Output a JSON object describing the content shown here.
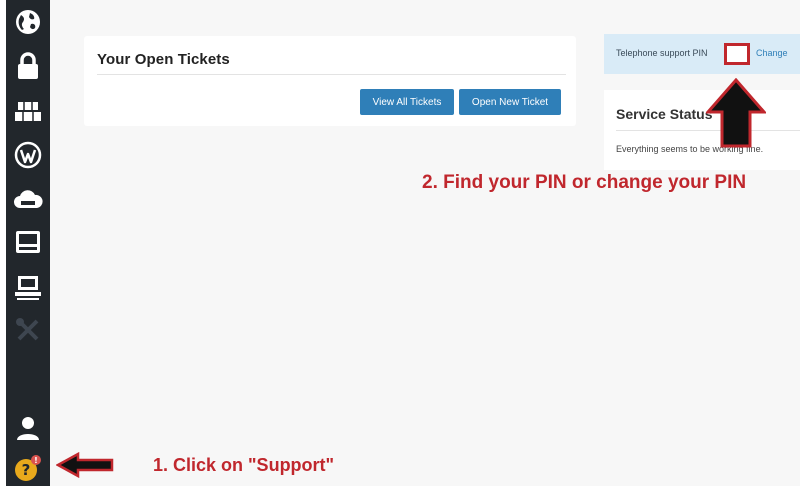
{
  "sidebar": {
    "items": [
      {
        "icon": "globe-icon"
      },
      {
        "icon": "lock-icon"
      },
      {
        "icon": "hosting-icon"
      },
      {
        "icon": "wordpress-icon"
      },
      {
        "icon": "cloud-icon"
      },
      {
        "icon": "server-icon"
      },
      {
        "icon": "dedicated-server-icon"
      },
      {
        "icon": "tools-icon"
      },
      {
        "icon": "user-icon"
      },
      {
        "icon": "support-icon",
        "badge": "!"
      }
    ]
  },
  "tickets": {
    "title": "Your Open Tickets",
    "view_all_label": "View All Tickets",
    "open_new_label": "Open New Ticket"
  },
  "pin": {
    "label": "Telephone support PIN",
    "change_label": "Change"
  },
  "service_status": {
    "title": "Service Status",
    "message": "Everything seems to be working fine."
  },
  "annotations": {
    "step1": "1. Click on \"Support\"",
    "step2": "2. Find your PIN or change your PIN"
  },
  "colors": {
    "sidebar_bg": "#22272c",
    "button_blue": "#2f7fb8",
    "annotation_red": "#c0272d",
    "pin_bar_bg": "#d9ebf7",
    "support_icon": "#e8a91c"
  }
}
